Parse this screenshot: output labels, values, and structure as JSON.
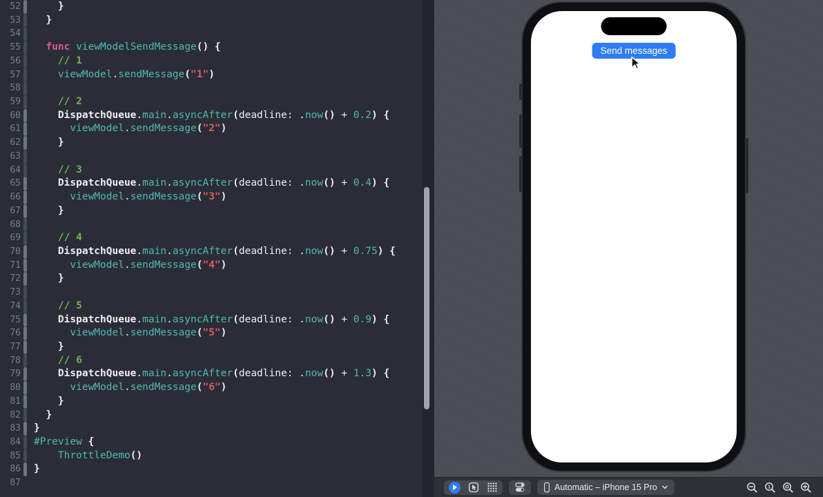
{
  "colors": {
    "editor-bg": "#2a2d37",
    "code-white": "#eceef2",
    "teal": "#52b8ae",
    "green": "#74b152",
    "red": "#e05a5c",
    "pink": "#dd5793",
    "gutter": "#787d87",
    "accent": "#2e7cf3",
    "canvas-bg": "#4b4f55",
    "toolbar-bg": "#2d3035",
    "group-bg": "#46484e",
    "icon": "#d9dbdf",
    "bar-bright": "#6e747e",
    "bar-dim": "#454a54",
    "scroll-thumb": "#a0a5ab"
  },
  "editor": {
    "lines": [
      {
        "n": 52,
        "bar": "bright",
        "s": [
          [
            "    }",
            "b"
          ]
        ]
      },
      {
        "n": 53,
        "bar": "dim",
        "s": [
          [
            "  }",
            "b"
          ]
        ]
      },
      {
        "n": 54,
        "bar": "dim",
        "s": []
      },
      {
        "n": 55,
        "bar": "dim",
        "s": [
          [
            "  ",
            ""
          ],
          [
            "func",
            "p"
          ],
          [
            " ",
            ""
          ],
          [
            "viewModelSendMessage",
            "t"
          ],
          [
            "() {",
            "b"
          ]
        ]
      },
      {
        "n": 56,
        "bar": "dim",
        "s": [
          [
            "    ",
            ""
          ],
          [
            "// 1",
            "g"
          ]
        ]
      },
      {
        "n": 57,
        "bar": "dim",
        "s": [
          [
            "    ",
            ""
          ],
          [
            "viewModel",
            "t"
          ],
          [
            ".",
            ""
          ],
          [
            "sendMessage",
            "t"
          ],
          [
            "(",
            "b"
          ],
          [
            "\"1\"",
            "r"
          ],
          [
            ")",
            "b"
          ]
        ]
      },
      {
        "n": 58,
        "bar": "dim",
        "s": []
      },
      {
        "n": 59,
        "bar": "dim",
        "s": [
          [
            "    ",
            ""
          ],
          [
            "// 2",
            "g"
          ]
        ]
      },
      {
        "n": 60,
        "bar": "bright",
        "s": [
          [
            "    ",
            ""
          ],
          [
            "DispatchQueue",
            "b"
          ],
          [
            ".",
            ""
          ],
          [
            "main",
            "t"
          ],
          [
            ".",
            ""
          ],
          [
            "asyncAfter",
            "t"
          ],
          [
            "(",
            "b"
          ],
          [
            "deadline:",
            ""
          ],
          [
            " .",
            ""
          ],
          [
            "now",
            "t"
          ],
          [
            "()",
            "b"
          ],
          [
            " + ",
            ""
          ],
          [
            "0.2",
            "t"
          ],
          [
            ") {",
            "b"
          ]
        ]
      },
      {
        "n": 61,
        "bar": "bright",
        "s": [
          [
            "      ",
            ""
          ],
          [
            "viewModel",
            "t"
          ],
          [
            ".",
            ""
          ],
          [
            "sendMessage",
            "t"
          ],
          [
            "(",
            "b"
          ],
          [
            "\"2\"",
            "r"
          ],
          [
            ")",
            "b"
          ]
        ]
      },
      {
        "n": 62,
        "bar": "bright",
        "s": [
          [
            "    }",
            "b"
          ]
        ]
      },
      {
        "n": 63,
        "bar": "dim",
        "s": []
      },
      {
        "n": 64,
        "bar": "dim",
        "s": [
          [
            "    ",
            ""
          ],
          [
            "// 3",
            "g"
          ]
        ]
      },
      {
        "n": 65,
        "bar": "bright",
        "s": [
          [
            "    ",
            ""
          ],
          [
            "DispatchQueue",
            "b"
          ],
          [
            ".",
            ""
          ],
          [
            "main",
            "t"
          ],
          [
            ".",
            ""
          ],
          [
            "asyncAfter",
            "t"
          ],
          [
            "(",
            "b"
          ],
          [
            "deadline:",
            ""
          ],
          [
            " .",
            ""
          ],
          [
            "now",
            "t"
          ],
          [
            "()",
            "b"
          ],
          [
            " + ",
            ""
          ],
          [
            "0.4",
            "t"
          ],
          [
            ") {",
            "b"
          ]
        ]
      },
      {
        "n": 66,
        "bar": "bright",
        "s": [
          [
            "      ",
            ""
          ],
          [
            "viewModel",
            "t"
          ],
          [
            ".",
            ""
          ],
          [
            "sendMessage",
            "t"
          ],
          [
            "(",
            "b"
          ],
          [
            "\"3\"",
            "r"
          ],
          [
            ")",
            "b"
          ]
        ]
      },
      {
        "n": 67,
        "bar": "bright",
        "s": [
          [
            "    }",
            "b"
          ]
        ]
      },
      {
        "n": 68,
        "bar": "dim",
        "s": []
      },
      {
        "n": 69,
        "bar": "dim",
        "s": [
          [
            "    ",
            ""
          ],
          [
            "// 4",
            "g"
          ]
        ]
      },
      {
        "n": 70,
        "bar": "bright",
        "s": [
          [
            "    ",
            ""
          ],
          [
            "DispatchQueue",
            "b"
          ],
          [
            ".",
            ""
          ],
          [
            "main",
            "t"
          ],
          [
            ".",
            ""
          ],
          [
            "asyncAfter",
            "t"
          ],
          [
            "(",
            "b"
          ],
          [
            "deadline:",
            ""
          ],
          [
            " .",
            ""
          ],
          [
            "now",
            "t"
          ],
          [
            "()",
            "b"
          ],
          [
            " + ",
            ""
          ],
          [
            "0.75",
            "t"
          ],
          [
            ") {",
            "b"
          ]
        ]
      },
      {
        "n": 71,
        "bar": "bright",
        "s": [
          [
            "      ",
            ""
          ],
          [
            "viewModel",
            "t"
          ],
          [
            ".",
            ""
          ],
          [
            "sendMessage",
            "t"
          ],
          [
            "(",
            "b"
          ],
          [
            "\"4\"",
            "r"
          ],
          [
            ")",
            "b"
          ]
        ]
      },
      {
        "n": 72,
        "bar": "bright",
        "s": [
          [
            "    }",
            "b"
          ]
        ]
      },
      {
        "n": 73,
        "bar": "dim",
        "s": []
      },
      {
        "n": 74,
        "bar": "dim",
        "s": [
          [
            "    ",
            ""
          ],
          [
            "// 5",
            "g"
          ]
        ]
      },
      {
        "n": 75,
        "bar": "bright",
        "s": [
          [
            "    ",
            ""
          ],
          [
            "DispatchQueue",
            "b"
          ],
          [
            ".",
            ""
          ],
          [
            "main",
            "t"
          ],
          [
            ".",
            ""
          ],
          [
            "asyncAfter",
            "t"
          ],
          [
            "(",
            "b"
          ],
          [
            "deadline:",
            ""
          ],
          [
            " .",
            ""
          ],
          [
            "now",
            "t"
          ],
          [
            "()",
            "b"
          ],
          [
            " + ",
            ""
          ],
          [
            "0.9",
            "t"
          ],
          [
            ") {",
            "b"
          ]
        ]
      },
      {
        "n": 76,
        "bar": "bright",
        "s": [
          [
            "      ",
            ""
          ],
          [
            "viewModel",
            "t"
          ],
          [
            ".",
            ""
          ],
          [
            "sendMessage",
            "t"
          ],
          [
            "(",
            "b"
          ],
          [
            "\"5\"",
            "r"
          ],
          [
            ")",
            "b"
          ]
        ]
      },
      {
        "n": 77,
        "bar": "bright",
        "s": [
          [
            "    }",
            "b"
          ]
        ]
      },
      {
        "n": 78,
        "bar": "dim",
        "s": [
          [
            "    ",
            ""
          ],
          [
            "// 6",
            "g"
          ]
        ]
      },
      {
        "n": 79,
        "bar": "bright",
        "s": [
          [
            "    ",
            ""
          ],
          [
            "DispatchQueue",
            "b"
          ],
          [
            ".",
            ""
          ],
          [
            "main",
            "t"
          ],
          [
            ".",
            ""
          ],
          [
            "asyncAfter",
            "t"
          ],
          [
            "(",
            "b"
          ],
          [
            "deadline:",
            ""
          ],
          [
            " .",
            ""
          ],
          [
            "now",
            "t"
          ],
          [
            "()",
            "b"
          ],
          [
            " + ",
            ""
          ],
          [
            "1.3",
            "t"
          ],
          [
            ") {",
            "b"
          ]
        ]
      },
      {
        "n": 80,
        "bar": "bright",
        "s": [
          [
            "      ",
            ""
          ],
          [
            "viewModel",
            "t"
          ],
          [
            ".",
            ""
          ],
          [
            "sendMessage",
            "t"
          ],
          [
            "(",
            "b"
          ],
          [
            "\"6\"",
            "r"
          ],
          [
            ")",
            "b"
          ]
        ]
      },
      {
        "n": 81,
        "bar": "bright",
        "s": [
          [
            "    }",
            "b"
          ]
        ]
      },
      {
        "n": 82,
        "bar": "dim",
        "s": [
          [
            "  }",
            "b"
          ]
        ]
      },
      {
        "n": 83,
        "bar": "bright",
        "s": [
          [
            "}",
            "b"
          ]
        ]
      },
      {
        "n": 84,
        "bar": "dim",
        "s": [
          [
            "#Preview",
            "t"
          ],
          [
            " {",
            "b"
          ]
        ]
      },
      {
        "n": 85,
        "bar": "dim",
        "s": [
          [
            "    ",
            ""
          ],
          [
            "ThrottleDemo",
            "t"
          ],
          [
            "()",
            "b"
          ]
        ]
      },
      {
        "n": 86,
        "bar": "bright",
        "s": [
          [
            "}",
            "b"
          ]
        ]
      },
      {
        "n": 87,
        "bar": "none",
        "s": []
      }
    ]
  },
  "simulator": {
    "send_button_label": "Send messages"
  },
  "toolbar": {
    "device_picker_label": "Automatic – iPhone 15 Pro",
    "icons": {
      "live_preview": "play-circle",
      "selectable_mode": "rounded-square-with-cursor-arrow",
      "variants": "dot-grid",
      "device_settings": "stacked-toggle-pills",
      "device": "iphone-outline",
      "picker_chevron": "chevron-down",
      "zoom_out": "magnifier-minus",
      "zoom_actual": "magnifier-1",
      "zoom_fit": "magnifier-ring",
      "zoom_in": "magnifier-plus"
    }
  }
}
